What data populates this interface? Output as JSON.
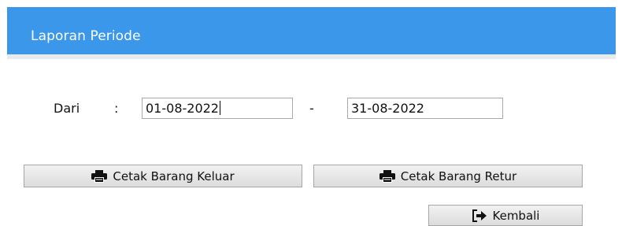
{
  "header": {
    "title": "Laporan Periode"
  },
  "form": {
    "from_label": "Dari",
    "colon": ":",
    "separator": "-",
    "from_value": "01-08-2022",
    "to_value": "31-08-2022"
  },
  "buttons": {
    "keluar_label": "Cetak Barang Keluar",
    "retur_label": "Cetak Barang Retur",
    "kembali_label": "Kembali"
  },
  "icons": {
    "print": "printer-icon",
    "exit": "arrow-right-icon"
  },
  "colors": {
    "header_bg": "#3a97ea",
    "header_text": "#ffffff"
  }
}
